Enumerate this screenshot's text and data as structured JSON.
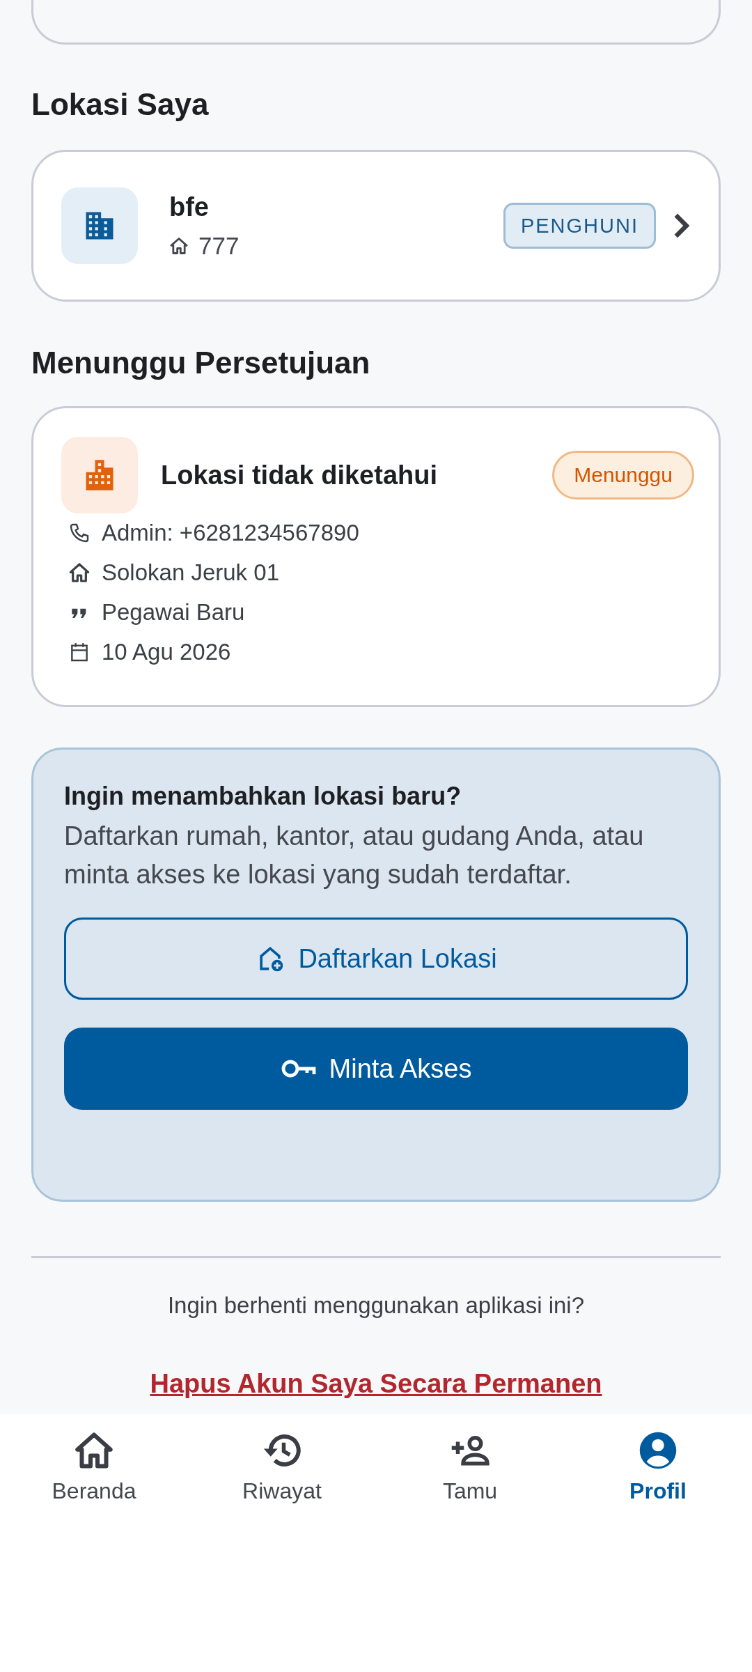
{
  "my_locations_title": "Lokasi Saya",
  "my_locations": [
    {
      "name": "bfe",
      "unit": "777",
      "role": "PENGHUNI"
    }
  ],
  "pending_title": "Menunggu Persetujuan",
  "pending": [
    {
      "name": "Lokasi tidak diketahui",
      "status": "Menunggu",
      "details": [
        {
          "kind": "phone",
          "text": "Admin: +6281234567890"
        },
        {
          "kind": "home",
          "text": "Solokan Jeruk 01"
        },
        {
          "kind": "quote",
          "text": "Pegawai Baru"
        },
        {
          "kind": "calendar",
          "text": "10 Agu 2026"
        }
      ]
    }
  ],
  "add_location": {
    "title": "Ingin menambahkan lokasi baru?",
    "description": "Daftarkan rumah, kantor, atau gudang Anda, atau minta akses ke lokasi yang sudah terdaftar.",
    "buttons": [
      {
        "kind": "outline",
        "label": "Daftarkan Lokasi"
      },
      {
        "kind": "filled",
        "label": "Minta Akses"
      }
    ]
  },
  "delete_account": {
    "question": "Ingin berhenti menggunakan aplikasi ini?",
    "link": "Hapus Akun Saya Secara Permanen"
  },
  "nav": [
    {
      "kind": "home",
      "label": "Beranda",
      "selected": false
    },
    {
      "kind": "history",
      "label": "Riwayat",
      "selected": false
    },
    {
      "kind": "guest",
      "label": "Tamu",
      "selected": false
    },
    {
      "kind": "profile",
      "label": "Profil",
      "selected": true
    }
  ]
}
